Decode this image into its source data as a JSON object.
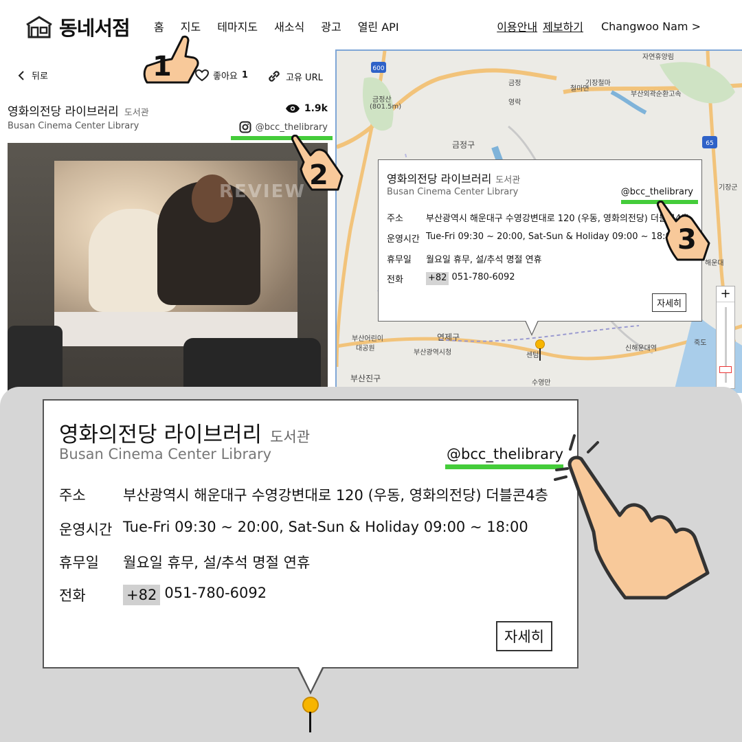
{
  "header": {
    "logo_text": "동네서점",
    "nav": [
      "홈",
      "지도",
      "테마지도",
      "새소식",
      "광고",
      "열린 API"
    ],
    "links": [
      "이용안내",
      "제보하기"
    ],
    "user": "Changwoo Nam >"
  },
  "detail": {
    "back_label": "뒤로",
    "like_label": "좋아요",
    "like_count": "1",
    "share_label": "고유 URL",
    "title": "영화의전당 라이브러리",
    "category": "도서관",
    "english_name": "Busan Cinema Center Library",
    "views": "1.9k",
    "instagram": "@bcc_thelibrary",
    "photo_watermark": "REVIEW"
  },
  "map_labels": [
    {
      "text": "자연휴양림"
    },
    {
      "text": "금정산"
    },
    {
      "text": "(801.5m)"
    },
    {
      "text": "금정"
    },
    {
      "text": "기장철마"
    },
    {
      "text": "철마면"
    },
    {
      "text": "영락"
    },
    {
      "text": "부산외곽순환고속"
    },
    {
      "text": "금정구"
    },
    {
      "text": "연제구"
    },
    {
      "text": "부산어린이"
    },
    {
      "text": "대공원"
    },
    {
      "text": "부산광역시청"
    },
    {
      "text": "신해운대역"
    },
    {
      "text": "해운대"
    },
    {
      "text": "죽도"
    },
    {
      "text": "부산진구"
    },
    {
      "text": "센텀"
    },
    {
      "text": "수영만"
    },
    {
      "text": "기장군"
    }
  ],
  "map_shields": [
    "600",
    "65"
  ],
  "popup": {
    "title": "영화의전당 라이브러리",
    "category": "도서관",
    "english_name": "Busan Cinema Center Library",
    "instagram": "@bcc_thelibrary",
    "address_label": "주소",
    "address": "부산광역시 해운대구 수영강변대로 120 (우동, 영화의전당) 더블콘4층",
    "hours_label": "운영시간",
    "hours": "Tue-Fri 09:30 ~ 20:00, Sat-Sun & Holiday 09:00 ~ 18:00",
    "closed_label": "휴무일",
    "closed": "월요일 휴무, 설/추석 명절 연휴",
    "phone_label": "전화",
    "phone_cc": "+82",
    "phone": "051-780-6092",
    "more_label": "자세히"
  },
  "popup_small": {
    "address": "부산광역시 해운대구 수영강변대로 120 (우동, 영화의전당) 더블콘4층",
    "hours": "Tue-Fri 09:30 ~ 20:00, Sat-Sun & Holiday 09:00 ~ 18:00"
  },
  "zoom_plus": "+",
  "steps": [
    "1",
    "2",
    "3"
  ],
  "colors": {
    "highlight": "#44cc3a",
    "pin": "#f7b500",
    "map_bg": "#ecebe6",
    "panel_bg": "#d6d6d6"
  }
}
